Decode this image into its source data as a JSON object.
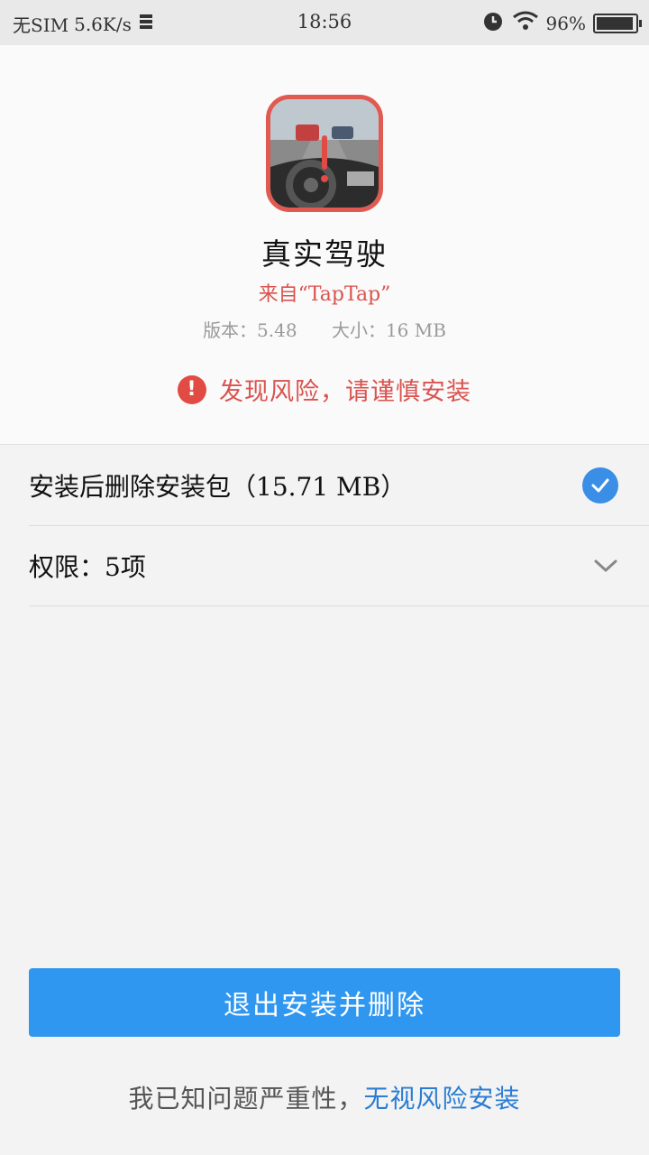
{
  "status_bar": {
    "sim": "无SIM",
    "speed": "5.6K/s",
    "time": "18:56",
    "battery": "96%",
    "battery_level": 0.96
  },
  "app": {
    "name": "真实驾驶",
    "source": "来自“TapTap”",
    "version": "版本：5.48",
    "size": "大小：16 MB"
  },
  "warning": {
    "text": "发现风险，请谨慎安装",
    "icon": "exclamation-icon",
    "color": "#d9534f"
  },
  "options": {
    "delete_package": {
      "label": "安装后删除安装包（15.71 MB）",
      "checked": true
    },
    "permissions": {
      "label": "权限：5项"
    }
  },
  "actions": {
    "exit_label": "退出安装并删除",
    "footer_text": "我已知问题严重性，",
    "ignore_label": "无视风险安装"
  },
  "colors": {
    "accent": "#2f97ef",
    "danger": "#e24b44",
    "link": "#2b7dd3"
  }
}
